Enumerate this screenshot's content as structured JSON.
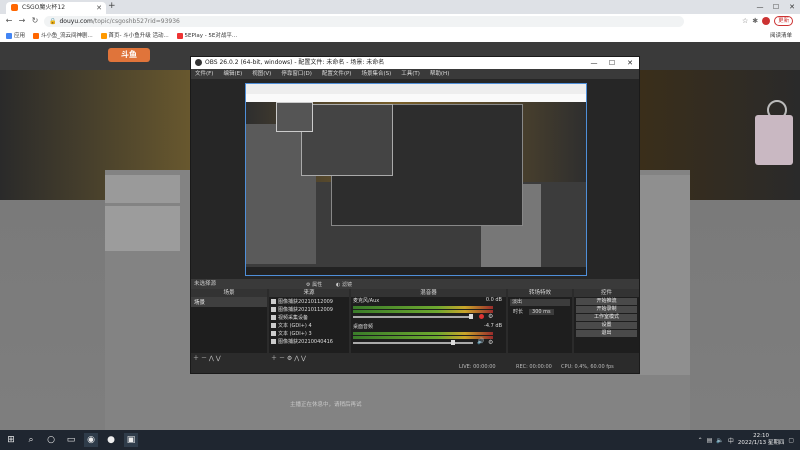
{
  "browser": {
    "tab_title": "CSGO魔火杯12",
    "new_tab_icon": "+",
    "window_controls": [
      "—",
      "☐",
      "✕"
    ],
    "url_host": "douyu.com",
    "url_path": "/topic/csgoshb527rid=93936",
    "update_label": "更新",
    "bookmarks": [
      "应用",
      "斗小鱼_流云间神剧...",
      "首页- 斗小鱼升级 活动...",
      "5EPlay - 5E对战平..."
    ],
    "reading_list": "阅读清单"
  },
  "site": {
    "logo": "斗鱼",
    "hint_text": "主播正在休息中，请稍后再试"
  },
  "obs": {
    "title": "OBS 26.0.2 (64-bit, windows) - 配置文件: 未命名 - 场景: 未命名",
    "menu": [
      "文件(F)",
      "编辑(E)",
      "视图(V)",
      "停靠窗口(D)",
      "配置文件(P)",
      "场景集合(S)",
      "工具(T)",
      "帮助(H)"
    ],
    "no_source": "未选择源",
    "properties": "属性",
    "filters": "滤镜",
    "docks": {
      "scenes": "场景",
      "sources": "来源",
      "mixer": "混音器",
      "transitions": "转场特效",
      "controls": "控件"
    },
    "scenes": [
      "场景"
    ],
    "sources": [
      "图像捕获20210112009",
      "图像捕获20210112009",
      "视频采集设备",
      "文本 (GDI+) 4",
      "文本 (GDI+) 3",
      "图像捕获20210040416"
    ],
    "mixer": [
      {
        "name": "麦克风/Aux",
        "db": "0.0 dB"
      },
      {
        "name": "桌面音频",
        "db": "-4.7 dB"
      }
    ],
    "transition": {
      "type": "淡出",
      "duration_label": "时长",
      "duration": "300 ms"
    },
    "controls": [
      "开始推流",
      "开始录制",
      "工作室模式",
      "设置",
      "退出"
    ],
    "status": {
      "live": "LIVE: 00:00:00",
      "rec": "REC: 00:00:00",
      "cpu": "CPU: 0.4%, 60.00 fps"
    }
  },
  "taskbar": {
    "time": "22:10",
    "date": "2022/1/13 星期四",
    "lang": "中"
  }
}
